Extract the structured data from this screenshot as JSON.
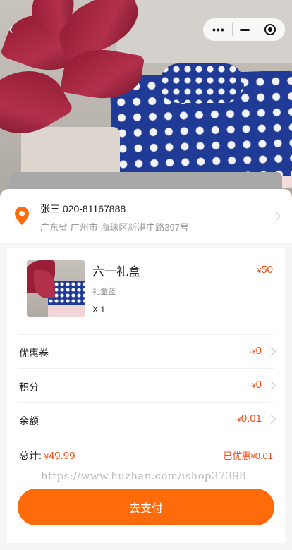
{
  "address": {
    "name": "张三",
    "phone": "020-81167888",
    "detail": "广东省 广州市 海珠区新港中路397号"
  },
  "product": {
    "title": "六一礼盒",
    "sku": "礼盒蓝",
    "quantity": "X 1",
    "currency": "¥",
    "price": "50"
  },
  "rows": [
    {
      "label": "优惠卷",
      "prefix": "-¥",
      "value": "0"
    },
    {
      "label": "积分",
      "prefix": "-¥",
      "value": "0"
    },
    {
      "label": "余额",
      "prefix": "-¥",
      "value": "0.01"
    }
  ],
  "summary": {
    "total_label": "总计:",
    "currency": "¥",
    "total_value": "49.99",
    "saved_label": "已优惠",
    "saved_value": "0.01"
  },
  "watermark": "https://www.huzhan.com/ishop37398",
  "pay_button": "去支付",
  "colors": {
    "accent": "#ff6a0a",
    "price": "#f04c16"
  }
}
